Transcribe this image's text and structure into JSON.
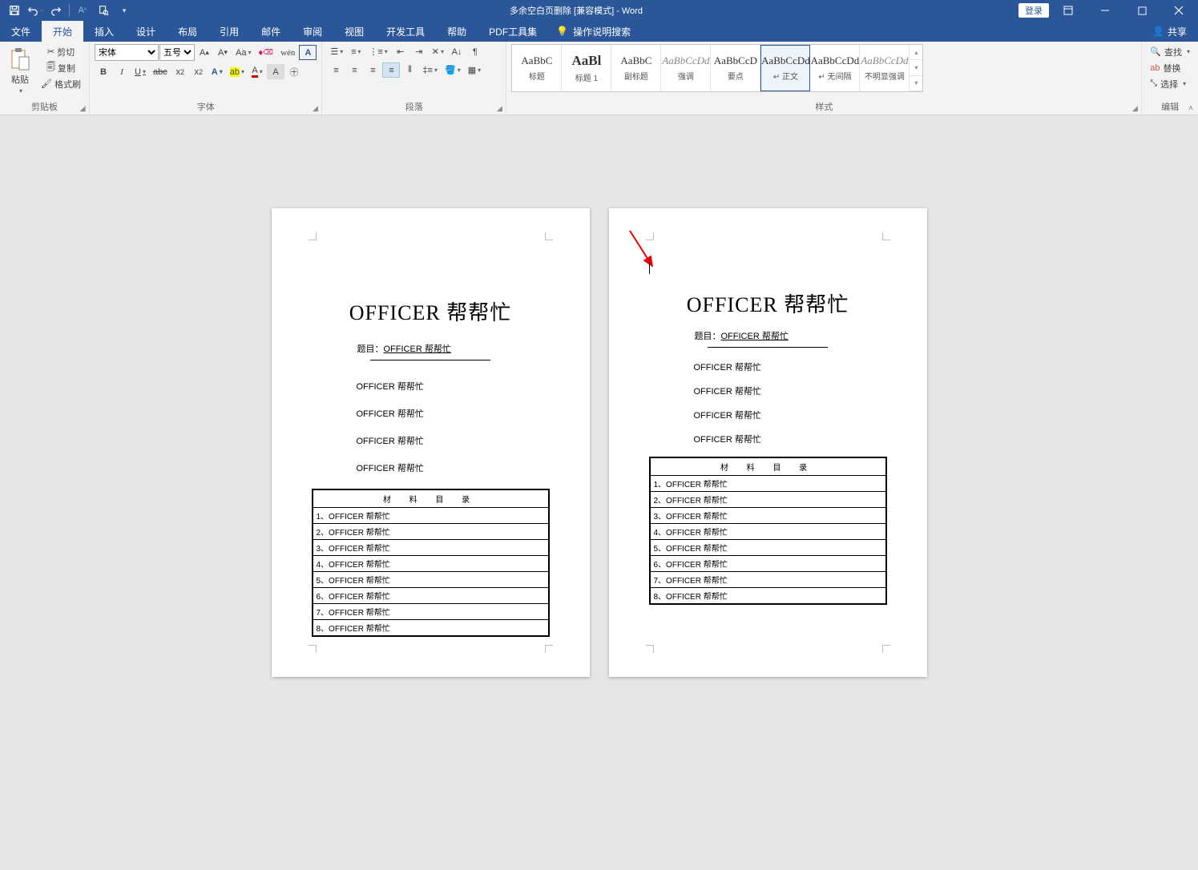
{
  "titlebar": {
    "doc_title": "多余空白页删除 [兼容模式] - Word",
    "login": "登录"
  },
  "tabs": {
    "file": "文件",
    "home": "开始",
    "insert": "插入",
    "design": "设计",
    "layout": "布局",
    "references": "引用",
    "mailings": "邮件",
    "review": "审阅",
    "view": "视图",
    "devtools": "开发工具",
    "help": "帮助",
    "pdf": "PDF工具集",
    "tellme": "操作说明搜索",
    "share": "共享"
  },
  "ribbon": {
    "clipboard": {
      "label": "剪贴板",
      "paste": "粘贴",
      "cut": "剪切",
      "copy": "复制",
      "format_painter": "格式刷"
    },
    "font": {
      "label": "字体",
      "name": "宋体",
      "size": "五号"
    },
    "paragraph": {
      "label": "段落"
    },
    "styles": {
      "label": "样式",
      "items": [
        {
          "preview": "AaBbC",
          "name": "标题",
          "cls": ""
        },
        {
          "preview": "AaBl",
          "name": "标题 1",
          "cls": "big"
        },
        {
          "preview": "AaBbC",
          "name": "副标题",
          "cls": ""
        },
        {
          "preview": "AaBbCcDd",
          "name": "强调",
          "cls": "ital"
        },
        {
          "preview": "AaBbCcD",
          "name": "要点",
          "cls": ""
        },
        {
          "preview": "AaBbCcDd",
          "name": "↵ 正文",
          "cls": ""
        },
        {
          "preview": "AaBbCcDd",
          "name": "↵ 无间隔",
          "cls": ""
        },
        {
          "preview": "AaBbCcDd",
          "name": "不明显强调",
          "cls": "ital"
        }
      ],
      "selected_index": 5
    },
    "editing": {
      "label": "编辑",
      "find": "查找",
      "replace": "替换",
      "select": "选择"
    }
  },
  "document": {
    "title": "OFFICER 帮帮忙",
    "topic_label": "题目：",
    "topic_value": "OFFICER 帮帮忙",
    "paragraphs": [
      "OFFICER 帮帮忙",
      "OFFICER 帮帮忙",
      "OFFICER 帮帮忙",
      "OFFICER 帮帮忙"
    ],
    "table_header": "材 料 目 录",
    "rows": [
      "1、OFFICER 帮帮忙",
      "2、OFFICER 帮帮忙",
      "3、OFFICER 帮帮忙",
      "4、OFFICER 帮帮忙",
      "5、OFFICER 帮帮忙",
      "6、OFFICER 帮帮忙",
      "7、OFFICER 帮帮忙",
      "8、OFFICER 帮帮忙"
    ]
  }
}
